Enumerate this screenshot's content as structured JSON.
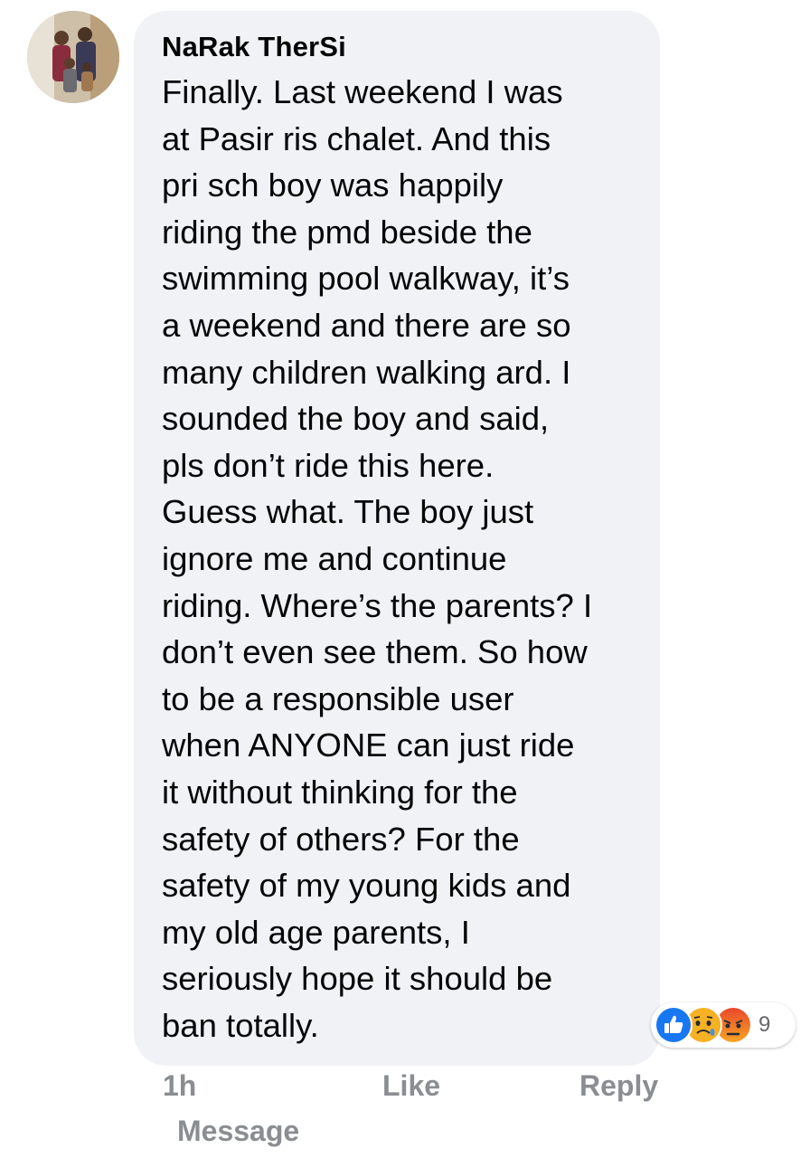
{
  "comment": {
    "author": "NaRak TherSi",
    "text": "Finally. Last weekend I was\nat Pasir ris chalet. And this\npri sch boy was happily\nriding the pmd beside the\nswimming  pool walkway, it’s\na weekend and there are so\nmany children walking ard. I\nsounded the boy and said,\npls don’t ride this here.\nGuess what. The boy just\nignore me and continue\nriding. Where’s the parents? I\ndon’t even see them. So how\nto be a responsible user\nwhen ANYONE can just ride\nit without thinking for the\nsafety of others? For the\nsafety of my young kids and\nmy old age parents, I\nseriously hope it should be\nban totally.",
    "avatar_icon": "profile-photo-avatar"
  },
  "reactions": {
    "icons": [
      "like-reaction-icon",
      "sad-reaction-icon",
      "angry-reaction-icon"
    ],
    "count": "9",
    "colors": {
      "like": "#1877f2",
      "sad": "#f7b125",
      "angry": "#e9710f"
    }
  },
  "actions": {
    "time": "1h",
    "like": "Like",
    "reply": "Reply",
    "message": "Message"
  },
  "colors": {
    "bubble": "#f0f2f5",
    "text": "#050505",
    "meta": "#8a8d91"
  }
}
